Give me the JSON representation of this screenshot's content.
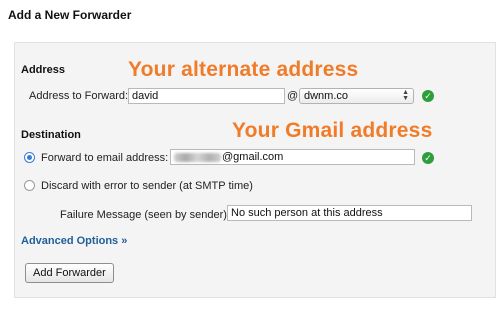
{
  "page": {
    "title": "Add a New Forwarder"
  },
  "address": {
    "section_title": "Address",
    "forward_label": "Address to Forward:",
    "forward_value": "david",
    "at_symbol": "@",
    "domain_selected": "dwnm.co"
  },
  "destination": {
    "section_title": "Destination",
    "forward_option_label": "Forward to email address:",
    "forward_email_visible": "@gmail.com",
    "discard_option_label": "Discard with error to sender (at SMTP time)",
    "failure_label": "Failure Message (seen by sender):",
    "failure_value": "No such person at this address"
  },
  "advanced_options_label": "Advanced Options »",
  "submit_label": "Add Forwarder",
  "annotations": {
    "alternate": "Your alternate address",
    "gmail": "Your Gmail address"
  },
  "colors": {
    "annotation": "#f07c2a",
    "link": "#1f5f9a",
    "valid_check": "#2e9e3b",
    "radio_selected": "#3b7bd8"
  },
  "icons": {
    "valid": "check-circle-icon",
    "dropdown": "select-arrows-icon"
  }
}
